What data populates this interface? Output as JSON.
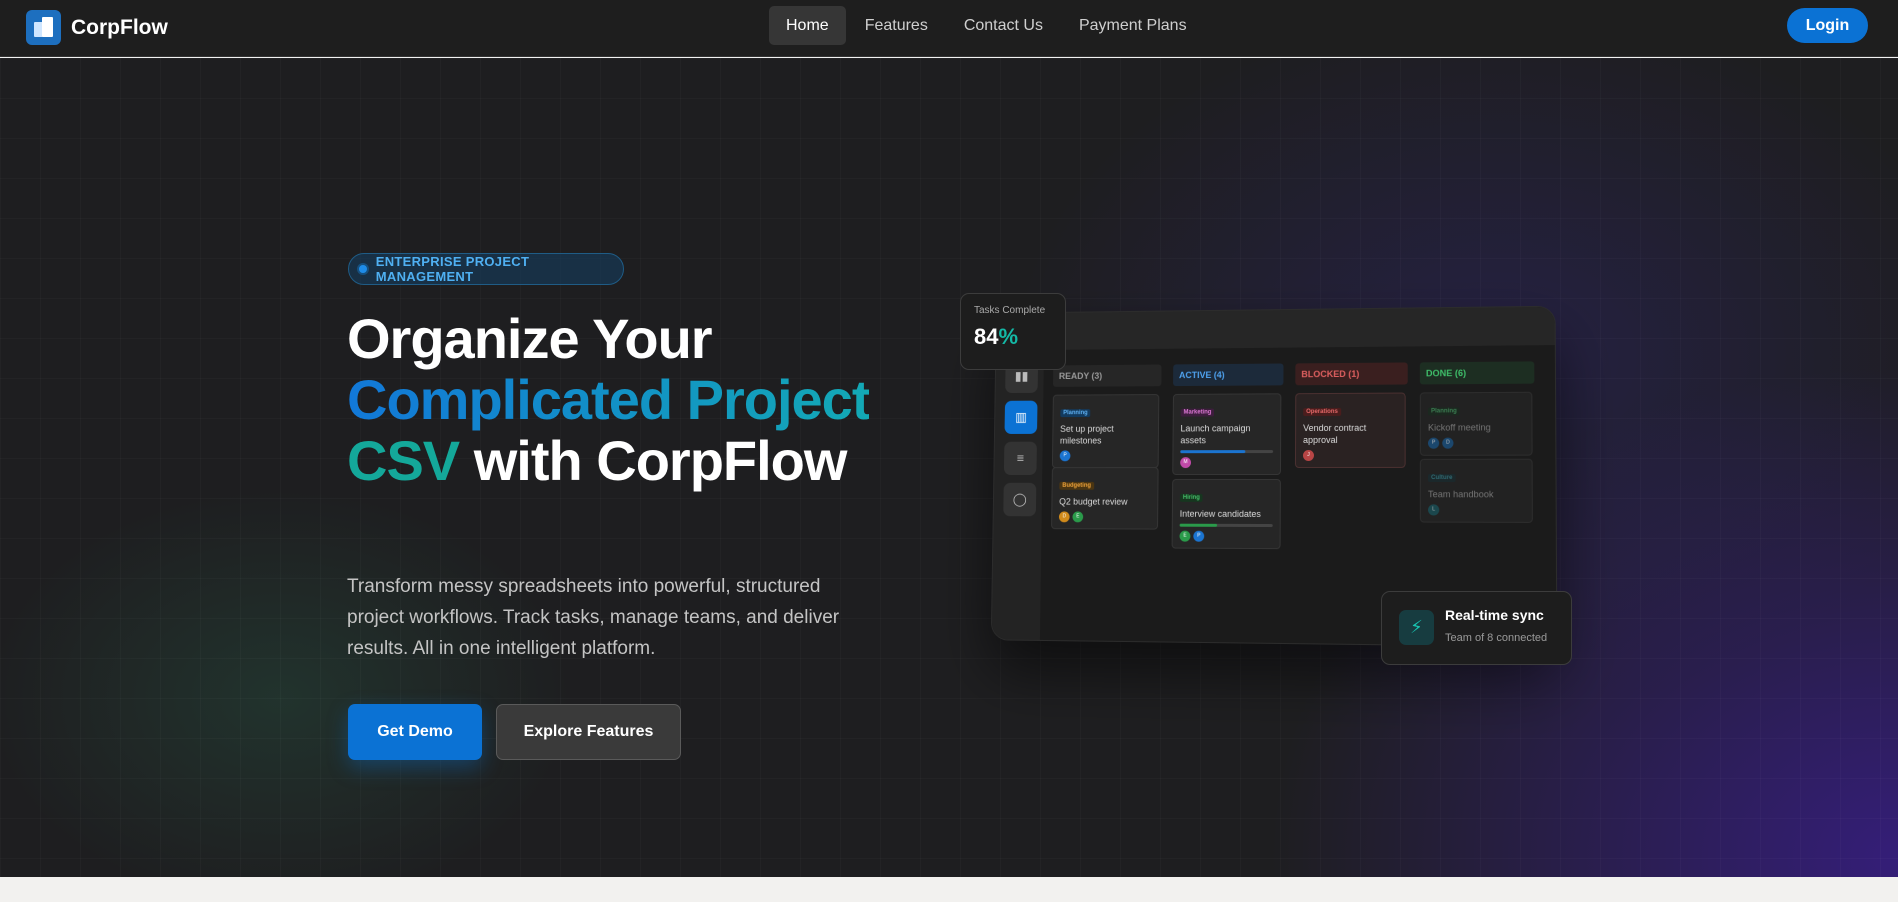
{
  "nav": {
    "brand": "CorpFlow",
    "links": [
      "Home",
      "Features",
      "Contact Us",
      "Payment Plans"
    ],
    "active_link": "Home",
    "login_label": "Login"
  },
  "hero": {
    "badge": "ENTERPRISE PROJECT MANAGEMENT",
    "headline": {
      "line1": "Organize Your",
      "line2": "Complicated Project",
      "line3_accent": "CSV",
      "line3_rest": " with CorpFlow"
    },
    "subtext": "Transform messy spreadsheets into powerful, structured project workflows. Track tasks, manage teams, and deliver results. All in one intelligent platform.",
    "primary_button": "Get Demo",
    "secondary_button": "Explore Features"
  },
  "board": {
    "columns": [
      {
        "label": "READY (3)",
        "color": "#9a9a9a"
      },
      {
        "label": "ACTIVE (4)",
        "color": "#4fa3f0"
      },
      {
        "label": "BLOCKED (1)",
        "color": "#e06060"
      },
      {
        "label": "DONE (6)",
        "color": "#3fbf6a"
      }
    ],
    "cards": {
      "ready": [
        {
          "tag": "Planning",
          "title": "Set up project milestones",
          "avatars": [
            "P"
          ]
        },
        {
          "tag": "Budgeting",
          "title": "Q2 budget review",
          "avatars": [
            "D",
            "E"
          ]
        }
      ],
      "active": [
        {
          "tag": "Marketing",
          "title": "Launch campaign assets",
          "avatars": [
            "M"
          ],
          "progress": 0.7
        },
        {
          "tag": "Hiring",
          "title": "Interview candidates",
          "avatars": [
            "E",
            "P"
          ],
          "progress": 0.4
        }
      ],
      "blocked": [
        {
          "tag": "Operations",
          "title": "Vendor contract approval",
          "avatars": [
            "J"
          ]
        }
      ],
      "done": [
        {
          "tag": "Planning",
          "title": "Kickoff meeting",
          "avatars": [
            "P",
            "D"
          ]
        },
        {
          "tag": "Culture",
          "title": "Team handbook",
          "avatars": [
            "L"
          ]
        }
      ]
    }
  },
  "stats": {
    "tasks_label": "Tasks Complete",
    "tasks_value": "84",
    "tasks_unit": "%",
    "sync_title": "Real-time sync",
    "sync_sub": "Team of 8 connected"
  },
  "colors": {
    "accent_blue": "#0b72d4",
    "accent_teal": "#14a89a"
  }
}
